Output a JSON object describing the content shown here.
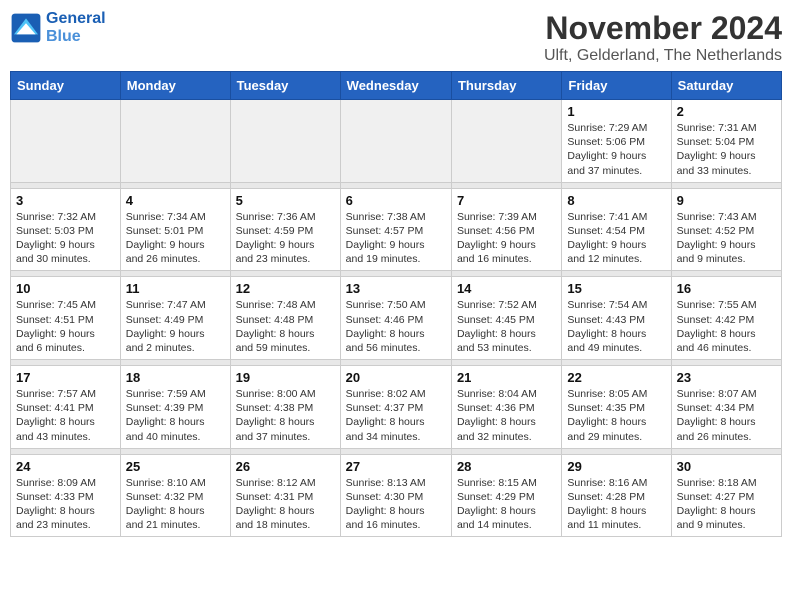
{
  "header": {
    "logo_line1": "General",
    "logo_line2": "Blue",
    "month": "November 2024",
    "location": "Ulft, Gelderland, The Netherlands"
  },
  "weekdays": [
    "Sunday",
    "Monday",
    "Tuesday",
    "Wednesday",
    "Thursday",
    "Friday",
    "Saturday"
  ],
  "weeks": [
    [
      {
        "day": "",
        "info": ""
      },
      {
        "day": "",
        "info": ""
      },
      {
        "day": "",
        "info": ""
      },
      {
        "day": "",
        "info": ""
      },
      {
        "day": "",
        "info": ""
      },
      {
        "day": "1",
        "info": "Sunrise: 7:29 AM\nSunset: 5:06 PM\nDaylight: 9 hours\nand 37 minutes."
      },
      {
        "day": "2",
        "info": "Sunrise: 7:31 AM\nSunset: 5:04 PM\nDaylight: 9 hours\nand 33 minutes."
      }
    ],
    [
      {
        "day": "3",
        "info": "Sunrise: 7:32 AM\nSunset: 5:03 PM\nDaylight: 9 hours\nand 30 minutes."
      },
      {
        "day": "4",
        "info": "Sunrise: 7:34 AM\nSunset: 5:01 PM\nDaylight: 9 hours\nand 26 minutes."
      },
      {
        "day": "5",
        "info": "Sunrise: 7:36 AM\nSunset: 4:59 PM\nDaylight: 9 hours\nand 23 minutes."
      },
      {
        "day": "6",
        "info": "Sunrise: 7:38 AM\nSunset: 4:57 PM\nDaylight: 9 hours\nand 19 minutes."
      },
      {
        "day": "7",
        "info": "Sunrise: 7:39 AM\nSunset: 4:56 PM\nDaylight: 9 hours\nand 16 minutes."
      },
      {
        "day": "8",
        "info": "Sunrise: 7:41 AM\nSunset: 4:54 PM\nDaylight: 9 hours\nand 12 minutes."
      },
      {
        "day": "9",
        "info": "Sunrise: 7:43 AM\nSunset: 4:52 PM\nDaylight: 9 hours\nand 9 minutes."
      }
    ],
    [
      {
        "day": "10",
        "info": "Sunrise: 7:45 AM\nSunset: 4:51 PM\nDaylight: 9 hours\nand 6 minutes."
      },
      {
        "day": "11",
        "info": "Sunrise: 7:47 AM\nSunset: 4:49 PM\nDaylight: 9 hours\nand 2 minutes."
      },
      {
        "day": "12",
        "info": "Sunrise: 7:48 AM\nSunset: 4:48 PM\nDaylight: 8 hours\nand 59 minutes."
      },
      {
        "day": "13",
        "info": "Sunrise: 7:50 AM\nSunset: 4:46 PM\nDaylight: 8 hours\nand 56 minutes."
      },
      {
        "day": "14",
        "info": "Sunrise: 7:52 AM\nSunset: 4:45 PM\nDaylight: 8 hours\nand 53 minutes."
      },
      {
        "day": "15",
        "info": "Sunrise: 7:54 AM\nSunset: 4:43 PM\nDaylight: 8 hours\nand 49 minutes."
      },
      {
        "day": "16",
        "info": "Sunrise: 7:55 AM\nSunset: 4:42 PM\nDaylight: 8 hours\nand 46 minutes."
      }
    ],
    [
      {
        "day": "17",
        "info": "Sunrise: 7:57 AM\nSunset: 4:41 PM\nDaylight: 8 hours\nand 43 minutes."
      },
      {
        "day": "18",
        "info": "Sunrise: 7:59 AM\nSunset: 4:39 PM\nDaylight: 8 hours\nand 40 minutes."
      },
      {
        "day": "19",
        "info": "Sunrise: 8:00 AM\nSunset: 4:38 PM\nDaylight: 8 hours\nand 37 minutes."
      },
      {
        "day": "20",
        "info": "Sunrise: 8:02 AM\nSunset: 4:37 PM\nDaylight: 8 hours\nand 34 minutes."
      },
      {
        "day": "21",
        "info": "Sunrise: 8:04 AM\nSunset: 4:36 PM\nDaylight: 8 hours\nand 32 minutes."
      },
      {
        "day": "22",
        "info": "Sunrise: 8:05 AM\nSunset: 4:35 PM\nDaylight: 8 hours\nand 29 minutes."
      },
      {
        "day": "23",
        "info": "Sunrise: 8:07 AM\nSunset: 4:34 PM\nDaylight: 8 hours\nand 26 minutes."
      }
    ],
    [
      {
        "day": "24",
        "info": "Sunrise: 8:09 AM\nSunset: 4:33 PM\nDaylight: 8 hours\nand 23 minutes."
      },
      {
        "day": "25",
        "info": "Sunrise: 8:10 AM\nSunset: 4:32 PM\nDaylight: 8 hours\nand 21 minutes."
      },
      {
        "day": "26",
        "info": "Sunrise: 8:12 AM\nSunset: 4:31 PM\nDaylight: 8 hours\nand 18 minutes."
      },
      {
        "day": "27",
        "info": "Sunrise: 8:13 AM\nSunset: 4:30 PM\nDaylight: 8 hours\nand 16 minutes."
      },
      {
        "day": "28",
        "info": "Sunrise: 8:15 AM\nSunset: 4:29 PM\nDaylight: 8 hours\nand 14 minutes."
      },
      {
        "day": "29",
        "info": "Sunrise: 8:16 AM\nSunset: 4:28 PM\nDaylight: 8 hours\nand 11 minutes."
      },
      {
        "day": "30",
        "info": "Sunrise: 8:18 AM\nSunset: 4:27 PM\nDaylight: 8 hours\nand 9 minutes."
      }
    ]
  ]
}
